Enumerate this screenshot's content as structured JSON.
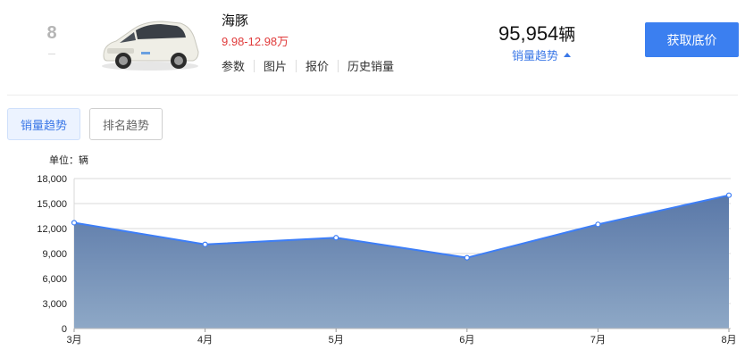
{
  "rank": "8",
  "car": {
    "name": "海豚",
    "price": "9.98-12.98万",
    "links": [
      "参数",
      "图片",
      "报价",
      "历史销量"
    ],
    "sales": "95,954",
    "sales_unit": "辆",
    "trend_link": "销量趋势",
    "cta": "获取底价"
  },
  "tabs": {
    "active": "销量趋势",
    "idle": "排名趋势"
  },
  "colors": {
    "accent": "#3b7ff0",
    "price": "#e03b3b",
    "line": "#3d7ef7",
    "area_top": "#5a78a8",
    "area_bottom": "#8ea8c6"
  },
  "chart_data": {
    "type": "area",
    "unit_label": "单位：辆",
    "categories": [
      "3月",
      "4月",
      "5月",
      "6月",
      "7月",
      "8月"
    ],
    "values": [
      12700,
      10100,
      10900,
      8500,
      12500,
      16000
    ],
    "ylim": [
      0,
      18000
    ],
    "yticks": [
      0,
      3000,
      6000,
      9000,
      12000,
      15000,
      18000
    ],
    "ytick_labels": [
      "0",
      "3,000",
      "6,000",
      "9,000",
      "12,000",
      "15,000",
      "18,000"
    ],
    "grid": true,
    "legend": "none"
  }
}
